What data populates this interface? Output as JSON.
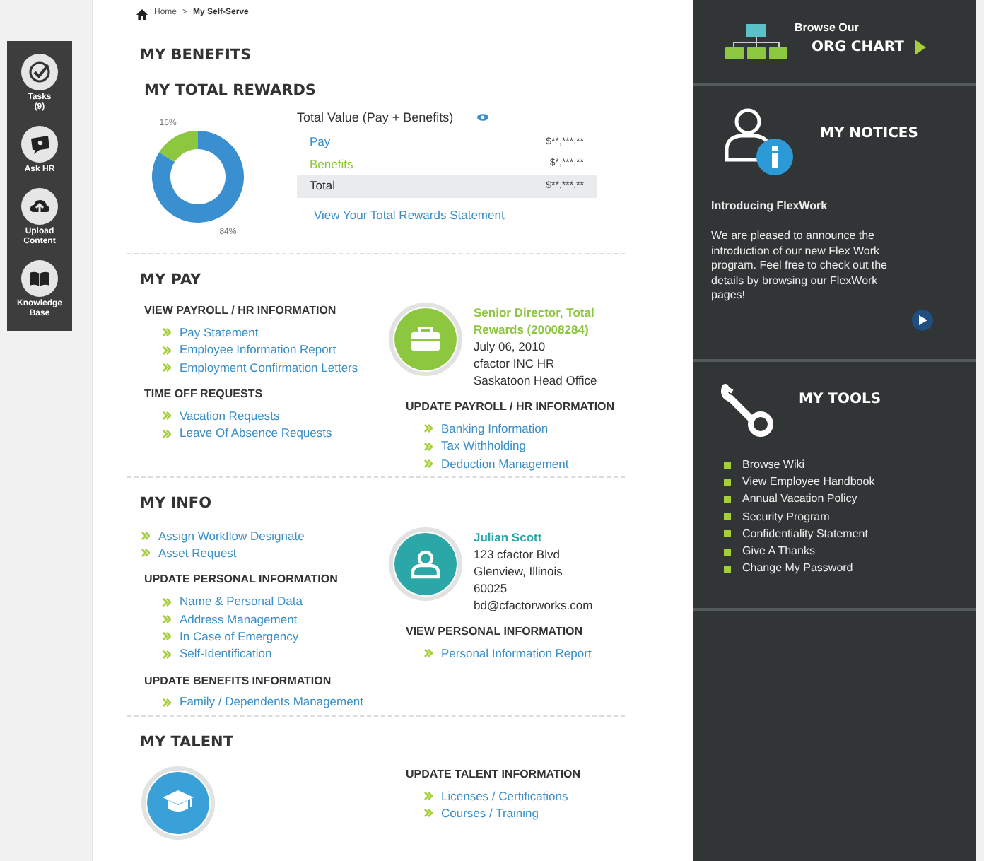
{
  "quick_actions": [
    {
      "kind": "tasks",
      "label": "Tasks\n(9)"
    },
    {
      "kind": "ask",
      "label": "Ask HR"
    },
    {
      "kind": "upload",
      "label": "Upload\nContent"
    },
    {
      "kind": "knowledge",
      "label": "Knowledge\nBase"
    }
  ],
  "breadcrumb": {
    "items": [
      "Home",
      "My Self-Serve"
    ],
    "separator": ">"
  },
  "benefits": {
    "title": "MY BENEFITS",
    "subtitle": "MY TOTAL REWARDS",
    "chart_data": {
      "type": "donut",
      "values": [
        84,
        16
      ],
      "value_labels": [
        "84%",
        "16%"
      ]
    },
    "summary_title": "Total Value (Pay + Benefits)",
    "rows": [
      {
        "label": "Pay",
        "value": "$**,***.**",
        "color": "#3a8fd0",
        "highlighted": false
      },
      {
        "label": "Benefits",
        "value": "$*,***.**",
        "color": "#8dc63f",
        "highlighted": false
      },
      {
        "label": "Total",
        "value": "$**,***.**",
        "color": "#333333",
        "highlighted": true
      }
    ],
    "link": "View Your Total Rewards Statement"
  },
  "sections": [
    {
      "title": "MY PAY",
      "columns": [
        [
          {
            "kind": "links",
            "heading": "VIEW PAYROLL / HR INFORMATION",
            "links": [
              "Pay Statement",
              "Employee Information Report",
              "Employment Confirmation Letters"
            ]
          },
          {
            "kind": "links",
            "heading": "TIME OFF REQUESTS",
            "links": [
              "Vacation Requests",
              "Leave Of Absence Requests"
            ]
          }
        ],
        [
          {
            "kind": "job",
            "title": "Senior Director, Total Rewards (20008284)",
            "lines": [
              "July 06, 2010",
              "cfactor INC HR",
              "Saskatoon Head Office"
            ]
          },
          {
            "kind": "links",
            "heading": "UPDATE PAYROLL / HR INFORMATION",
            "links": [
              "Banking Information",
              "Tax Withholding",
              "Deduction Management"
            ]
          }
        ]
      ]
    },
    {
      "title": "MY INFO",
      "columns": [
        [
          {
            "kind": "links",
            "links": [
              "Assign Workflow Designate",
              "Asset Request"
            ]
          },
          {
            "kind": "links",
            "heading": "UPDATE PERSONAL INFORMATION",
            "links": [
              "Name & Personal Data",
              "Address Management",
              "In Case of Emergency",
              "Self-Identification"
            ]
          },
          {
            "kind": "links",
            "heading": "UPDATE BENEFITS INFORMATION",
            "links": [
              "Family / Dependents Management"
            ]
          }
        ],
        [
          {
            "kind": "person",
            "title": "Julian Scott",
            "lines": [
              "123 cfactor Blvd",
              "Glenview, Illinois",
              "60025",
              "bd@cfactorworks.com"
            ]
          },
          {
            "kind": "links",
            "heading": "VIEW PERSONAL INFORMATION",
            "links": [
              "Personal Information Report"
            ]
          }
        ]
      ]
    },
    {
      "title": "MY TALENT",
      "columns": [
        [
          {
            "kind": "talent"
          }
        ],
        [
          {
            "kind": "links",
            "heading": "UPDATE TALENT INFORMATION",
            "links": [
              "Licenses / Certifications",
              "Courses / Training"
            ]
          }
        ]
      ]
    }
  ],
  "org_chart": {
    "line1": "Browse Our",
    "line2": "ORG CHART"
  },
  "notices": {
    "title": "MY NOTICES",
    "headline": "Introducing FlexWork",
    "body": "We are pleased to announce the introduction of our new Flex Work program. Feel free to check out the details by browsing our FlexWork pages!"
  },
  "tools": {
    "title": "MY TOOLS",
    "items": [
      "Browse Wiki",
      "View Employee Handbook",
      "Annual Vacation Policy",
      "Security Program",
      "Confidentiality Statement",
      "Give A Thanks",
      "Change My Password"
    ]
  }
}
